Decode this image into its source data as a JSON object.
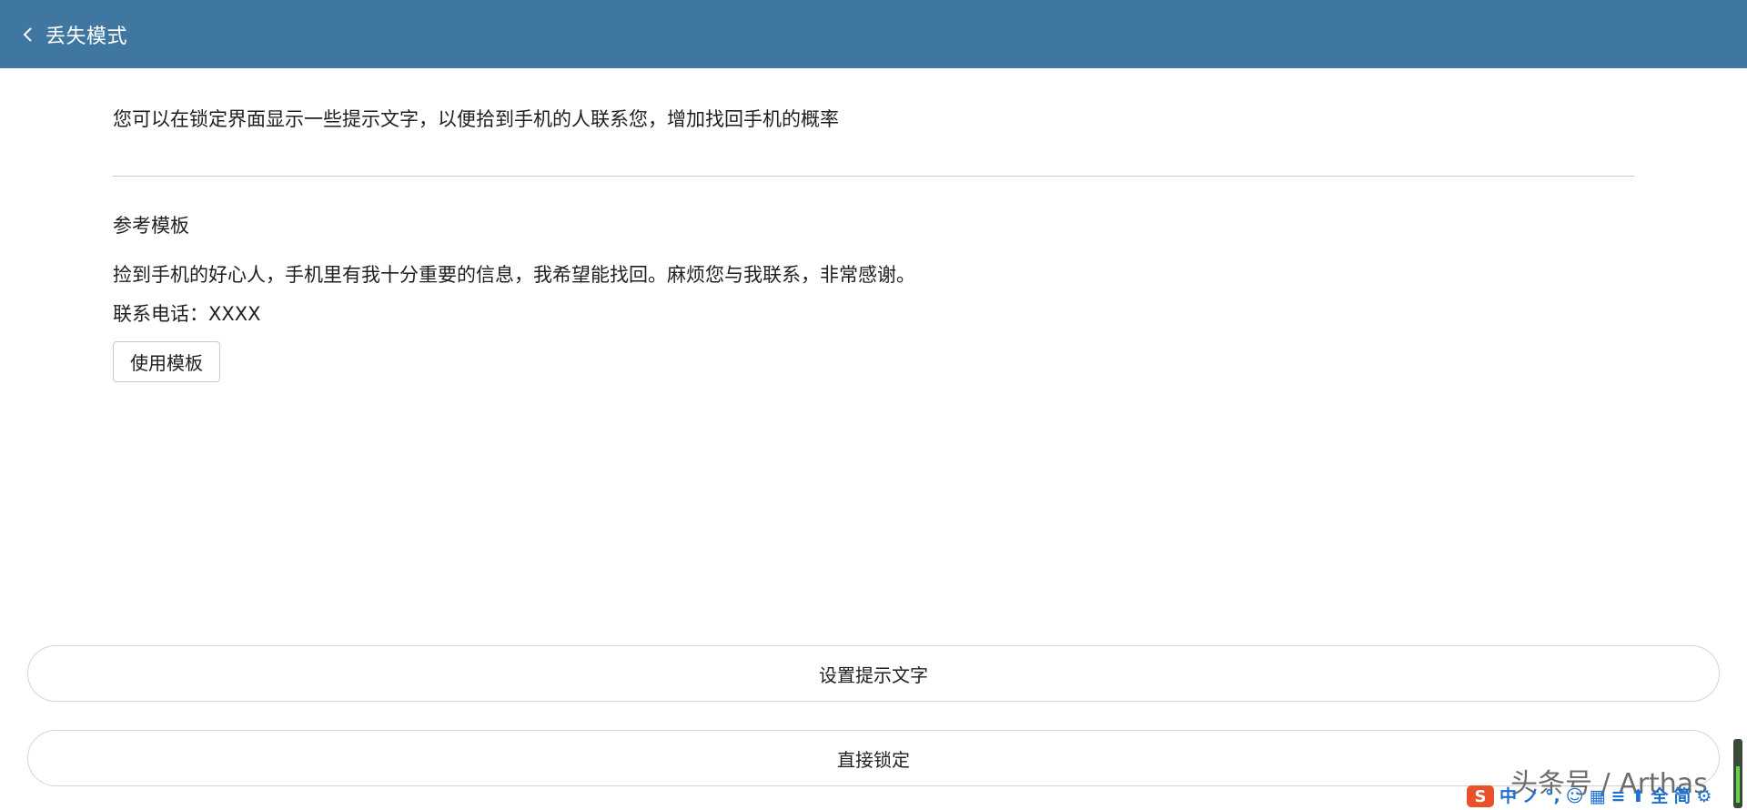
{
  "header": {
    "title": "丢失模式",
    "back_icon": "chevron-left-icon"
  },
  "intro": "您可以在锁定界面显示一些提示文字，以便拾到手机的人联系您，增加找回手机的概率",
  "template": {
    "heading": "参考模板",
    "body": "捡到手机的好心人，手机里有我十分重要的信息，我希望能找回。麻烦您与我联系，非常感谢。",
    "phone": "联系电话：XXXX",
    "use_button": "使用模板"
  },
  "actions": {
    "set_text": "设置提示文字",
    "lock_now": "直接锁定"
  },
  "watermark": "头条号 / Arthas",
  "ime": {
    "logo": "S",
    "items": [
      "中",
      "ノ",
      "°,",
      "☺",
      "▦",
      "≡",
      "⬆",
      "全",
      "简",
      "⚙"
    ]
  },
  "colors": {
    "header_bg": "#3f77a0",
    "ime_logo": "#e8512a",
    "ime_item": "#1e6fd0"
  }
}
